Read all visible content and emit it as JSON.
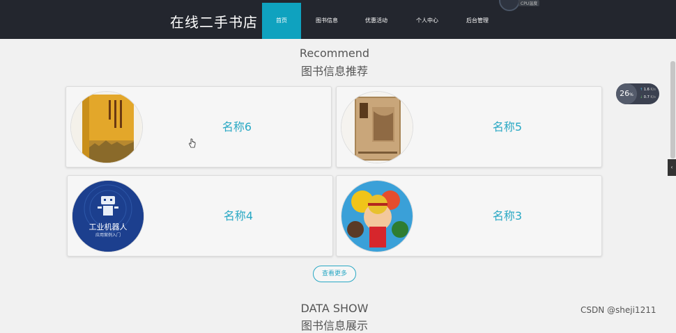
{
  "header": {
    "brand": "在线二手书店",
    "nav": [
      {
        "label": "首页",
        "active": true
      },
      {
        "label": "图书信息",
        "active": false
      },
      {
        "label": "优惠活动",
        "active": false
      },
      {
        "label": "个人中心",
        "active": false
      },
      {
        "label": "后台管理",
        "active": false
      }
    ],
    "gauge_label": "CPU温度"
  },
  "recommend": {
    "title_en": "Recommend",
    "title_cn": "图书信息推荐",
    "items": [
      {
        "name": "名称6"
      },
      {
        "name": "名称5"
      },
      {
        "name": "名称4"
      },
      {
        "name": "名称3"
      }
    ],
    "more_label": "查看更多"
  },
  "data_show": {
    "title_en": "DATA SHOW",
    "title_cn": "图书信息展示"
  },
  "widget": {
    "value": "26",
    "unit": "%",
    "up": "1.6",
    "down": "0.7",
    "speed_unit": "K/s"
  },
  "watermark": "CSDN @sheji1211",
  "colors": {
    "nav_bg": "#23262e",
    "accent": "#0fa2bf",
    "name_text": "#29a8c4"
  }
}
